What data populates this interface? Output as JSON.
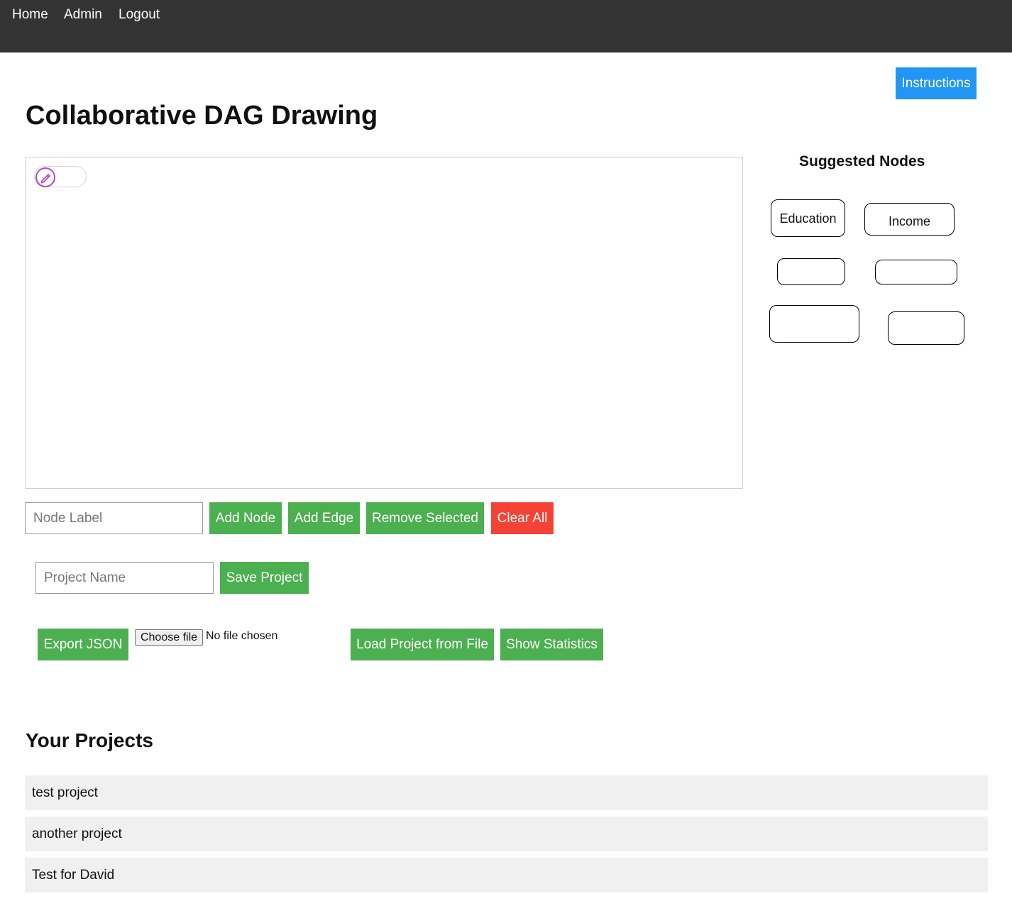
{
  "nav": {
    "home": "Home",
    "admin": "Admin",
    "logout": "Logout"
  },
  "instructions_label": "Instructions",
  "page_title": "Collaborative DAG Drawing",
  "canvas": {
    "draw_mode_toggle_icon": "pencil-icon",
    "accent_color": "#b44bd1"
  },
  "suggested": {
    "title": "Suggested Nodes",
    "nodes": [
      "Education",
      "Income",
      "",
      "",
      "",
      ""
    ]
  },
  "node_controls": {
    "node_label_placeholder": "Node Label",
    "add_node": "Add Node",
    "add_edge": "Add Edge",
    "remove_selected": "Remove Selected",
    "clear_all": "Clear All"
  },
  "project_controls": {
    "project_name_placeholder": "Project Name",
    "save_project": "Save Project",
    "export_json": "Export JSON",
    "choose_file": "Choose file",
    "no_file": "No file chosen",
    "load_project": "Load Project from File",
    "show_statistics": "Show Statistics"
  },
  "projects": {
    "title": "Your Projects",
    "items": [
      "test project",
      "another project",
      "Test for David"
    ]
  },
  "colors": {
    "navbar": "#333333",
    "green": "#4caf50",
    "red": "#f44336",
    "blue": "#2196f3",
    "row_bg": "#f0f0f0"
  }
}
